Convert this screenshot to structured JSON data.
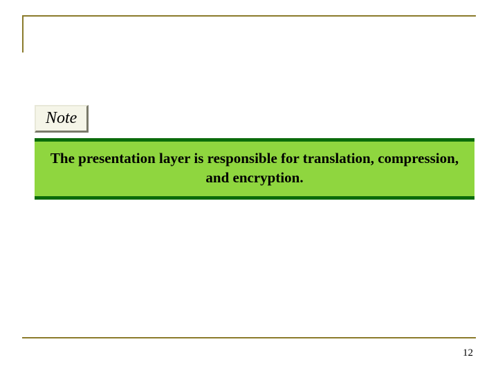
{
  "note": {
    "label": "Note"
  },
  "callout": {
    "text": "The presentation layer is responsible for translation, compression, and encryption."
  },
  "page_number": "12"
}
